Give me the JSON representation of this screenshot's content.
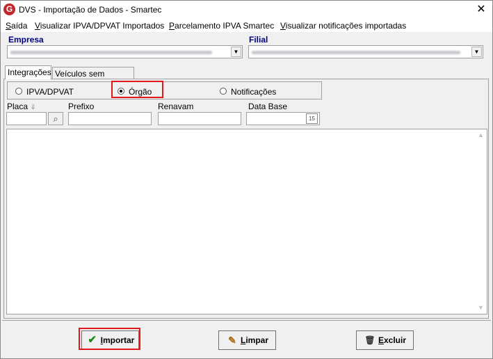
{
  "window": {
    "title": "DVS - Importação de Dados - Smartec",
    "logo_letter": "G",
    "close_glyph": "✕"
  },
  "menu": {
    "items": [
      {
        "accel": "S",
        "rest": "aída"
      },
      {
        "accel": "V",
        "rest": "isualizar IPVA/DPVAT Importados"
      },
      {
        "accel": "P",
        "rest": "arcelamento IPVA Smartec"
      },
      {
        "accel": "V",
        "rest": "isualizar notificações importadas"
      }
    ]
  },
  "empresa": {
    "label": "Empresa"
  },
  "filial": {
    "label": "Filial"
  },
  "tabs": [
    {
      "label": "Integrações",
      "active": true
    },
    {
      "label": "Veículos sem renavam",
      "active": false
    }
  ],
  "radios": [
    {
      "label": "IPVA/DPVAT",
      "checked": false
    },
    {
      "label": "Órgão",
      "checked": true
    },
    {
      "label": "Notificações",
      "checked": false
    }
  ],
  "fields": {
    "placa": "Placa",
    "placa_sort_glyph": "⇓",
    "prefixo": "Prefixo",
    "renavam": "Renavam",
    "data_base": "Data Base",
    "calendar_glyph": "15",
    "search_glyph": "⌕"
  },
  "buttons": {
    "importar": {
      "accel": "I",
      "rest": "mportar",
      "icon": "✔"
    },
    "limpar": {
      "accel": "L",
      "rest": "impar",
      "icon": "✎"
    },
    "excluir": {
      "accel": "E",
      "rest": "xcluir",
      "icon": "🗑"
    }
  },
  "scroll": {
    "up": "▲",
    "down": "▼"
  },
  "colors": {
    "highlight": "#e0181e",
    "label_blue": "#000080",
    "check_green": "#1a8a1a"
  }
}
